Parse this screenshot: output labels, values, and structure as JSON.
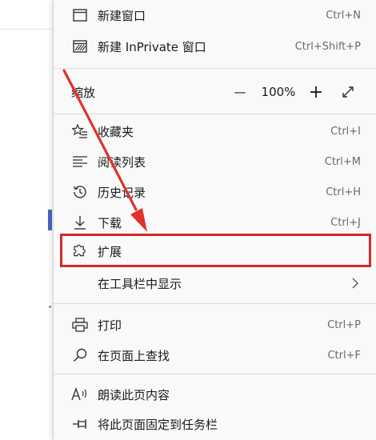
{
  "menu": {
    "items": [
      {
        "id": "new-window",
        "label": "新建窗口",
        "shortcut": "Ctrl+N",
        "icon": "window-icon"
      },
      {
        "id": "new-inprivate",
        "label": "新建 InPrivate 窗口",
        "shortcut": "Ctrl+Shift+P",
        "icon": "inprivate-icon"
      },
      {
        "id": "favorites",
        "label": "收藏夹",
        "shortcut": "Ctrl+I",
        "icon": "star-list-icon"
      },
      {
        "id": "reading-list",
        "label": "阅读列表",
        "shortcut": "Ctrl+M",
        "icon": "reading-list-icon"
      },
      {
        "id": "history",
        "label": "历史记录",
        "shortcut": "Ctrl+H",
        "icon": "history-icon"
      },
      {
        "id": "downloads",
        "label": "下载",
        "shortcut": "Ctrl+J",
        "icon": "download-icon"
      },
      {
        "id": "extensions",
        "label": "扩展",
        "shortcut": "",
        "icon": "puzzle-icon"
      },
      {
        "id": "show-in-toolbar",
        "label": "在工具栏中显示",
        "shortcut": "",
        "icon": "chevron-right-icon"
      },
      {
        "id": "print",
        "label": "打印",
        "shortcut": "Ctrl+P",
        "icon": "printer-icon"
      },
      {
        "id": "find",
        "label": "在页面上查找",
        "shortcut": "Ctrl+F",
        "icon": "search-icon"
      },
      {
        "id": "read-aloud",
        "label": "朗读此页内容",
        "shortcut": "",
        "icon": "read-aloud-icon"
      },
      {
        "id": "pin-taskbar",
        "label": "将此页面固定到任务栏",
        "shortcut": "",
        "icon": "pin-icon"
      }
    ],
    "zoom": {
      "label": "缩放",
      "minus": "—",
      "value": "100%",
      "plus": "+",
      "fullscreen_icon": "expand-icon"
    }
  },
  "annotation": {
    "color": "#d12a2a",
    "highlighted_item": "extensions"
  }
}
